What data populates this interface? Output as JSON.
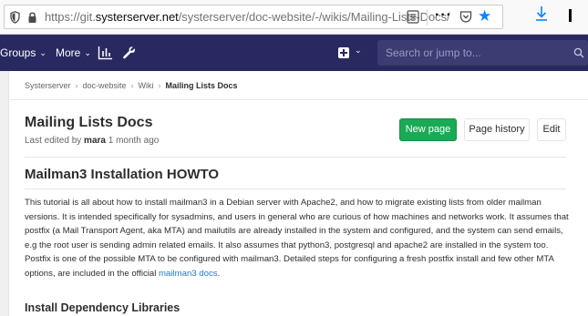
{
  "browser": {
    "url_prefix": "https://git.",
    "url_host": "systerserver.net",
    "url_path": "/systerserver/doc-website/-/wikis/Mailing-Lists-Docs/",
    "menu_dots": "···",
    "bookmark_star": "★",
    "icons": [
      "shield-icon",
      "lock-icon",
      "reader-view-icon",
      "pocket-icon",
      "bookmark-star-icon",
      "download-icon"
    ]
  },
  "navbar": {
    "groups_label": "Groups",
    "more_label": "More",
    "search_placeholder": "Search or jump to...",
    "icons": [
      "activity-chart-icon",
      "wrench-icon",
      "plus-square-icon",
      "search-icon"
    ],
    "colors": {
      "background": "#292961",
      "search_background": "#3c3c73"
    }
  },
  "breadcrumbs": [
    "Systerserver",
    "doc-website",
    "Wiki",
    "Mailing Lists Docs"
  ],
  "page": {
    "title": "Mailing Lists Docs",
    "last_edited_prefix": "Last edited by",
    "last_edited_user": "mara",
    "last_edited_time": "1 month ago"
  },
  "buttons": {
    "new_page": "New page",
    "page_history": "Page history",
    "edit": "Edit",
    "colors": {
      "new_page": "#1aaa55"
    }
  },
  "article": {
    "heading": "Mailman3 Installation HOWTO",
    "paragraph": "This tutorial is all about how to install mailman3 in a Debian server with Apache2, and how to migrate existing lists from older mailman versions. It is intended specifically for sysadmins, and users in general who are curious of how machines and networks work. It assumes that postfix (a Mail Transport Agent, aka MTA) and mailutils are already installed in the system and configured, and the system can send emails, e.g the root user is sending admin related emails. It also assumes that python3, postgresql and apache2 are installed in the system too. Postfix is one of the possible MTA to be configured with mailman3. Detailed steps for configuring a fresh postfix install and few other MTA options, are included in the official ",
    "link_text": "mailman3 docs",
    "paragraph_end": ".",
    "subheading": "Install Dependency Libraries"
  }
}
